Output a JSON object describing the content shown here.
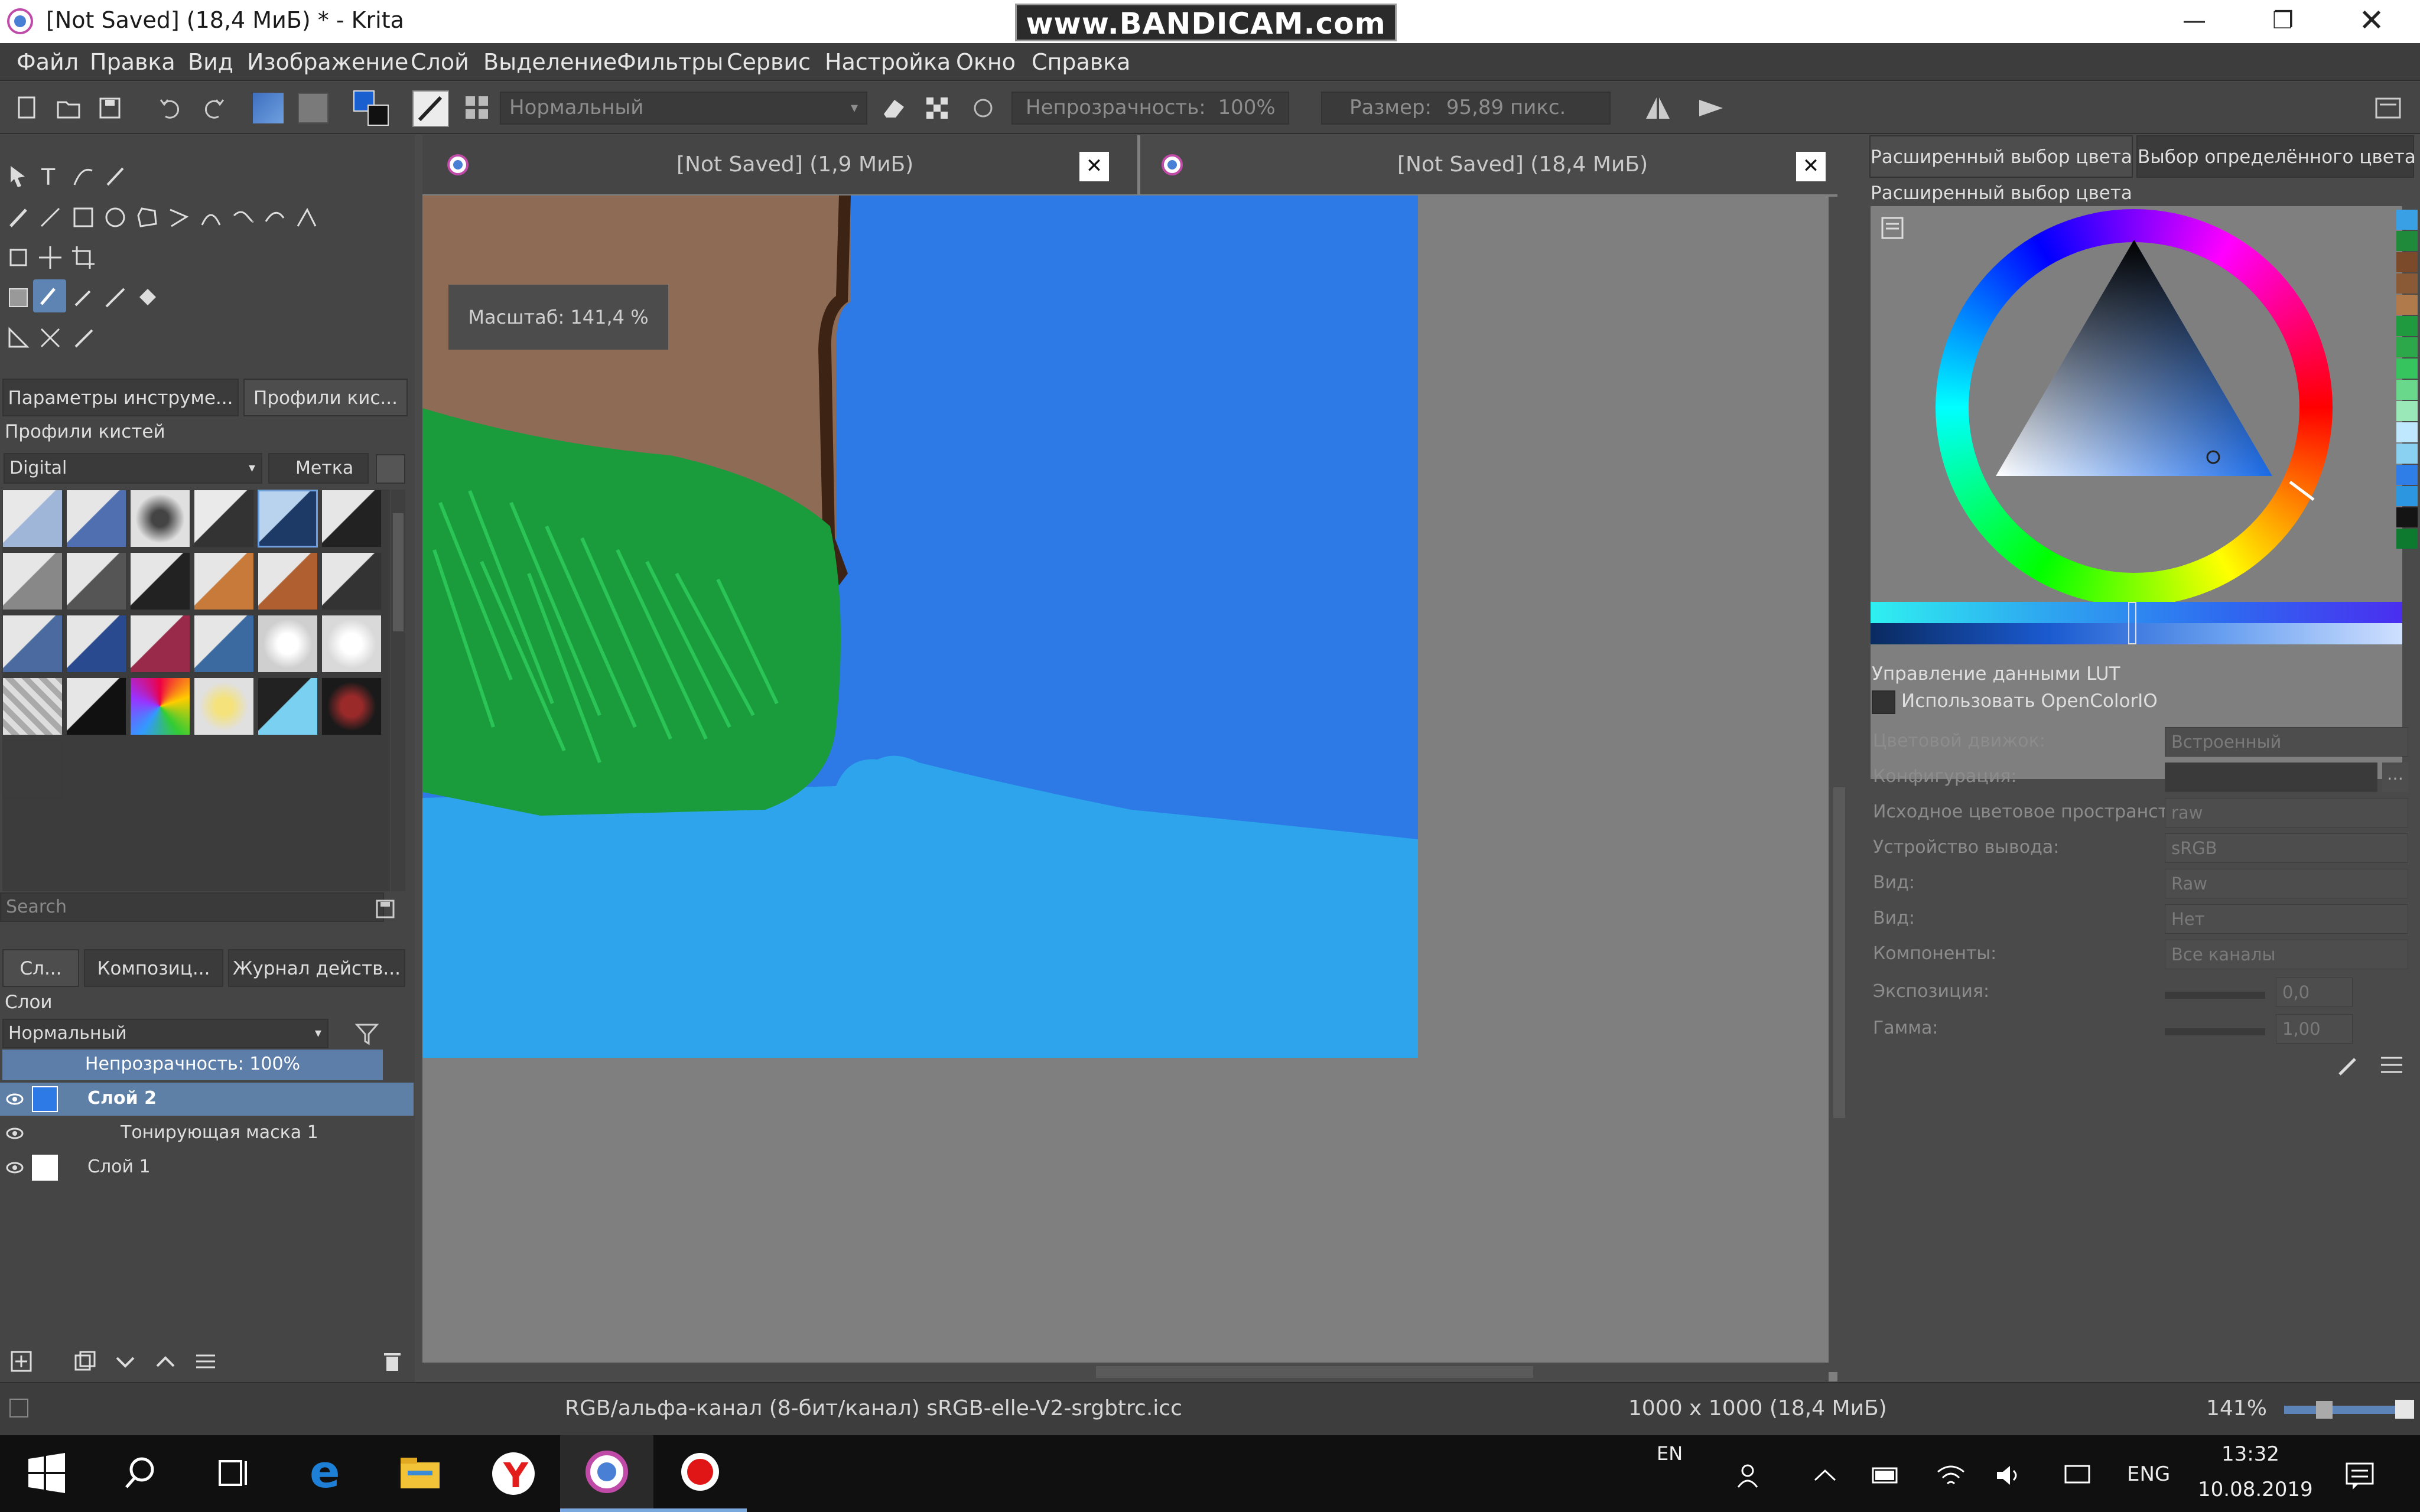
{
  "window": {
    "title": "[Not Saved]  (18,4 МиБ) * - Krita",
    "watermark": "www.BANDICAM.com",
    "minimize_icon": "minimize-icon",
    "maximize_icon": "restore-icon",
    "close_icon": "close-icon"
  },
  "menu": [
    "Файл",
    "Правка",
    "Вид",
    "Изображение",
    "Слой",
    "Выделение",
    "Фильтры",
    "Сервис",
    "Настройка",
    "Окно",
    "Справка"
  ],
  "toolbar": {
    "blend_mode": "Нормальный",
    "opacity_label": "Непрозрачность:",
    "opacity_value": "100%",
    "size_label": "Размер:",
    "size_value": "95,89 пикс."
  },
  "left_dock": {
    "tabs": [
      "Параметры инструме...",
      "Профили кис..."
    ],
    "brush_presets_title": "Профили кистей",
    "brush_tag": "Digital",
    "tag_button": "Метка",
    "search_placeholder": "Search",
    "layer_tabs": [
      "Сл...",
      "Композиц...",
      "Журнал действ..."
    ],
    "layers_title": "Слои",
    "layer_blend": "Нормальный",
    "layer_opacity": "Непрозрачность:  100%",
    "layers": [
      {
        "name": "Слой 2",
        "selected": true
      },
      {
        "name": "Тонирующая маска 1",
        "selected": false
      },
      {
        "name": "Слой 1",
        "selected": false
      }
    ]
  },
  "canvas": {
    "tabs": [
      "[Not Saved]  (1,9 МиБ)",
      "[Not Saved]  (18,4 МиБ)"
    ],
    "zoom_tooltip": "Масштаб:  141,4 %",
    "colors": {
      "brown": "#8d6b55",
      "sky": "#2d7ae6",
      "water": "#2da4ec",
      "grass": "#1b9c3c",
      "grass_light": "#2ecc5c",
      "outline": "#3c2314"
    }
  },
  "right_dock": {
    "tabs": [
      "Расширенный выбор цвета",
      "Выбор определённого цвета"
    ],
    "color_panel_title": "Расширенный выбор цвета",
    "lut_title": "Управление данными LUT",
    "use_ocio": "Использовать OpenColorIO",
    "settings": [
      {
        "label": "Цветовой движок:",
        "value": "Встроенный"
      },
      {
        "label": "Конфигурация:",
        "value": ""
      },
      {
        "label": "Исходное цветовое пространство:",
        "value": "raw"
      },
      {
        "label": "Устройство вывода:",
        "value": "sRGB"
      },
      {
        "label": "Вид:",
        "value": "Raw"
      },
      {
        "label": "Вид:",
        "value": "Нет"
      },
      {
        "label": "Компоненты:",
        "value": "Все каналы"
      },
      {
        "label": "Экспозиция:",
        "value": "0,0"
      },
      {
        "label": "Гамма:",
        "value": "1,00"
      }
    ],
    "swatches": [
      "#3aa0e6",
      "#1e8a3a",
      "#7a4a2a",
      "#8a5a36",
      "#b07a4a",
      "#1f9a3e",
      "#2ca84a",
      "#36c45e",
      "#6ad88a",
      "#9ae8b8",
      "#bfe8ff",
      "#8ad0f0",
      "#2f7ee8",
      "#2d96e0",
      "#141414",
      "#0d7a2f"
    ]
  },
  "statusbar": {
    "color_info": "RGB/альфа-канал (8-бит/канал)  sRGB-elle-V2-srgbtrc.icc",
    "size_info": "1000 x 1000 (18,4 МиБ)",
    "zoom": "141%"
  },
  "taskbar": {
    "lang_top": "EN",
    "lang": "ENG",
    "time": "13:32",
    "date": "10.08.2019"
  }
}
